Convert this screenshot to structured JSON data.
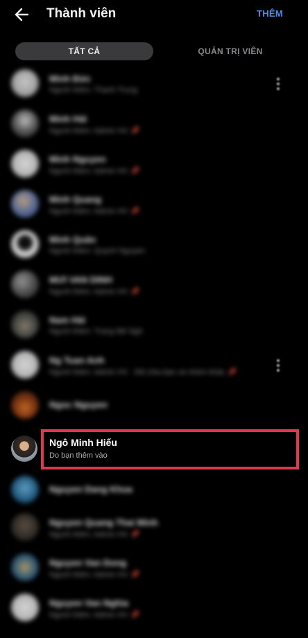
{
  "header": {
    "title": "Thành viên",
    "add_label": "THÊM",
    "back_icon": "arrow-left-icon"
  },
  "tabs": [
    {
      "label": "TẤT CẢ",
      "selected": true
    },
    {
      "label": "QUẢN TRỊ VIÊN",
      "selected": false
    }
  ],
  "members": [
    {
      "name": "Minh Đức",
      "subtitle": "Người thêm: Thanh Trung",
      "pinned": false,
      "menu": true
    },
    {
      "name": "Minh Hải",
      "subtitle": "Người thêm: Admin HV",
      "pinned": true,
      "menu": false
    },
    {
      "name": "Minh Nguyen",
      "subtitle": "Người thêm: Admin HV",
      "pinned": true,
      "menu": false
    },
    {
      "name": "Minh Quang",
      "subtitle": "Người thêm: Admin HV",
      "pinned": true,
      "menu": false
    },
    {
      "name": "Minh Quân",
      "subtitle": "Người thêm: Quynh Nguyen",
      "pinned": false,
      "menu": false
    },
    {
      "name": "MƯI VAN DINH",
      "subtitle": "Người thêm: Admin HV",
      "pinned": true,
      "menu": false
    },
    {
      "name": "Nam Hải",
      "subtitle": "Người thêm: Trang Mê Ngô",
      "pinned": false,
      "menu": false
    },
    {
      "name": "Ng Tuan Anh",
      "subtitle": "Người thêm: Admin HV · Đã chia bạn và nhóm khác",
      "pinned": true,
      "menu": true
    },
    {
      "name": "Ngoc Nguyen",
      "subtitle": "",
      "pinned": false,
      "menu": false
    },
    {
      "name": "Ngô Minh Hiếu",
      "subtitle": "Do bạn thêm vào",
      "pinned": false,
      "menu": false,
      "highlighted": true
    },
    {
      "name": "Nguyen Dang Khoa",
      "subtitle": "",
      "pinned": false,
      "menu": false
    },
    {
      "name": "Nguyen Quang Thai Minh",
      "subtitle": "Người thêm: Admin HV",
      "pinned": true,
      "menu": false
    },
    {
      "name": "Nguyen Van Dong",
      "subtitle": "Người thêm: Admin HV",
      "pinned": true,
      "menu": false
    },
    {
      "name": "Nguyen Van Nghia",
      "subtitle": "Người thêm: Admin HV",
      "pinned": true,
      "menu": false
    }
  ],
  "colors": {
    "accent": "#4a8fe7",
    "highlight_border": "#e0384d",
    "tab_selected_bg": "#3a3a3c"
  }
}
